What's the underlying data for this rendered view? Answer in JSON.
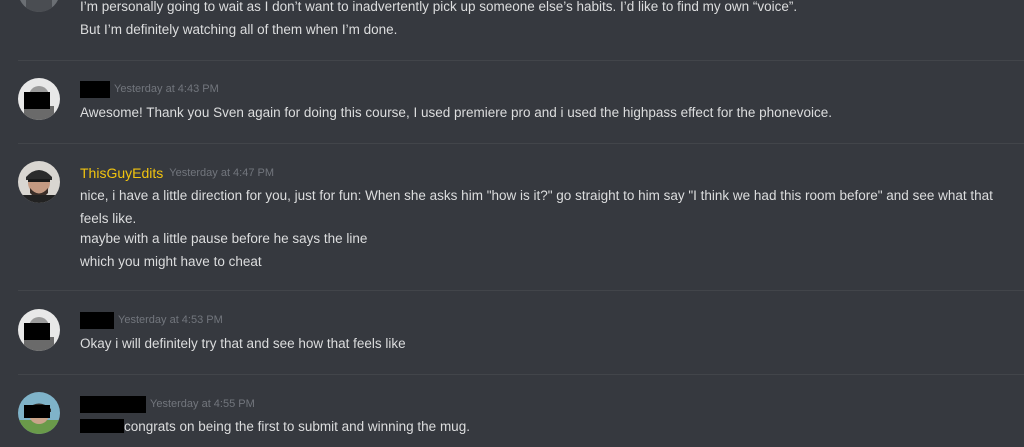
{
  "messages": [
    {
      "lines": [
        "I’m personally going to wait as I don’t want to inadvertently pick up someone else’s habits. I’d like to find my own “voice”.",
        "But I’m definitely watching all of them when I’m done."
      ]
    },
    {
      "timestamp": "Yesterday at 4:43 PM",
      "lines": [
        "Awesome! Thank you Sven again for doing this course, I used premiere pro and i used the highpass effect for the phonevoice."
      ]
    },
    {
      "username": "ThisGuyEdits",
      "username_color": "#f1c40f",
      "timestamp": "Yesterday at 4:47 PM",
      "lines": [
        "nice, i have a little direction for you, just for fun: When she asks him \"how  is it?\" go straight to him say \"I think we had this room before\" and see what that feels like.",
        "maybe with a little pause before he says the line",
        "which you might have to cheat"
      ]
    },
    {
      "timestamp": "Yesterday at 4:53 PM",
      "lines": [
        "Okay i will definitely try that and see how that feels like"
      ]
    },
    {
      "timestamp": "Yesterday at 4:55 PM",
      "lines": [
        "congrats on being the first to submit and winning the mug."
      ]
    }
  ],
  "colors": {
    "background": "#36393f",
    "text": "#dcddde",
    "timestamp": "#72767d",
    "highlight_username": "#f1c40f"
  }
}
